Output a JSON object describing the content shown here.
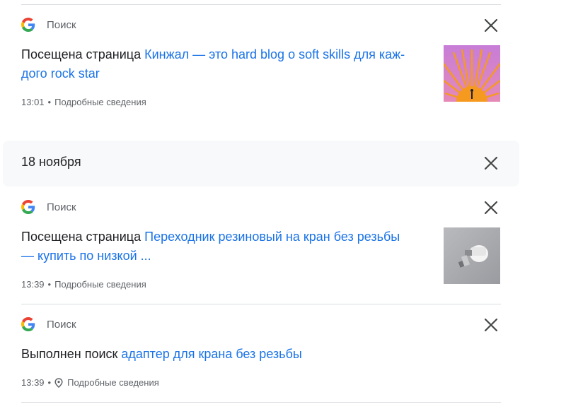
{
  "entries": [
    {
      "source": "Поиск",
      "prefix": "Посещена страница ",
      "link_line1": "Кинжал — это hard blog о soft skills для каж-",
      "link_line2": "дого rock star",
      "time": "13:01",
      "details": "Подробные сведения"
    },
    {
      "source": "Поиск",
      "prefix": "Посещена страница ",
      "link_line1": "Переходник резиновый на кран без резьбы",
      "link_line2": "— купить по низкой ...",
      "time": "13:39",
      "details": "Подробные сведения"
    },
    {
      "source": "Поиск",
      "prefix": "Выполнен поиск ",
      "link_line1": "адаптер для крана без резьбы",
      "time": "13:39",
      "details": "Подробные сведения"
    }
  ],
  "date_header": "18 ноября",
  "separator": "•",
  "icons": {
    "google": "google-g-icon",
    "close": "close-icon",
    "location": "location-pin-icon"
  },
  "colors": {
    "link": "#1a73e8",
    "text": "#202124",
    "muted": "#5f6368",
    "date_bar": "#f8f9fa"
  }
}
